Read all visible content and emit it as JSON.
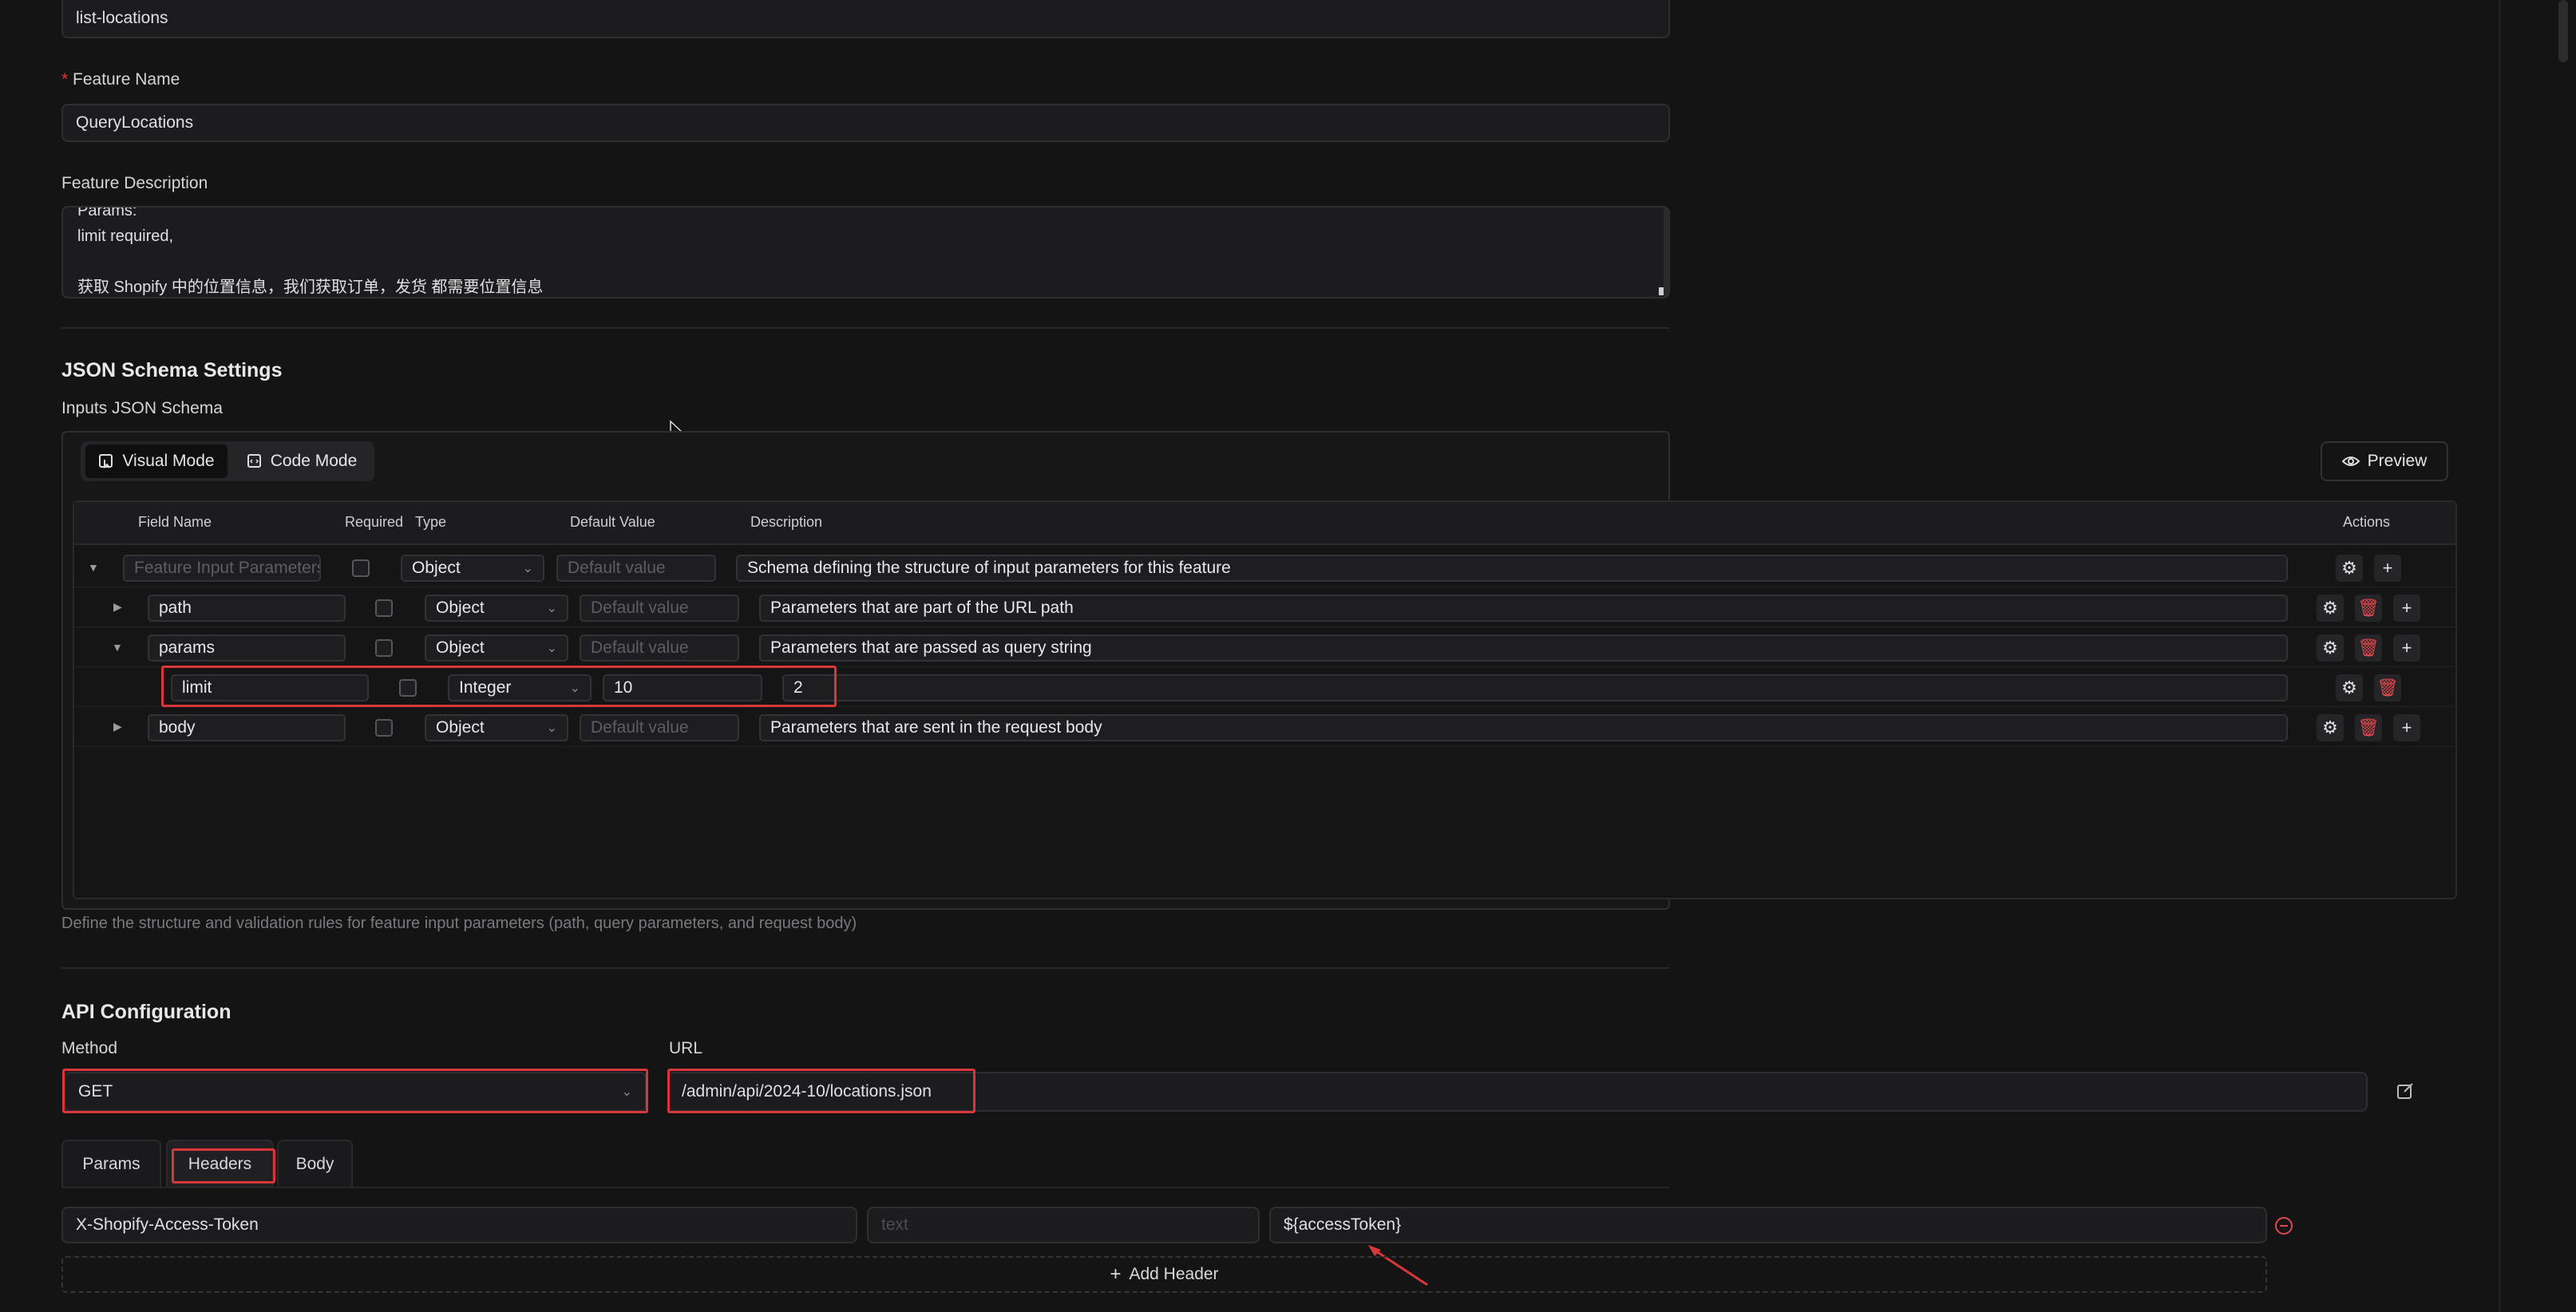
{
  "top_field": {
    "value": "list-locations"
  },
  "feature_name": {
    "label": "Feature Name",
    "required_mark": "*",
    "value": "QueryLocations"
  },
  "feature_description": {
    "label": "Feature Description",
    "lines": [
      "Params:",
      "limit required,",
      "",
      "获取 Shopify 中的位置信息，我们获取订单，发货 都需要位置信息"
    ]
  },
  "json_schema": {
    "title": "JSON Schema Settings",
    "subtitle": "Inputs JSON Schema",
    "mode_visual": "Visual Mode",
    "mode_code": "Code Mode",
    "preview": "Preview",
    "columns": {
      "field_name": "Field Name",
      "required": "Required",
      "type": "Type",
      "default_value": "Default Value",
      "description": "Description",
      "actions": "Actions"
    },
    "root": {
      "name_placeholder": "Feature Input Parameters",
      "type": "Object",
      "default_placeholder": "Default value",
      "description": "Schema defining the structure of input parameters for this feature"
    },
    "rows": {
      "path": {
        "name": "path",
        "type": "Object",
        "default_placeholder": "Default value",
        "description": "Parameters that are part of the URL path"
      },
      "params": {
        "name": "params",
        "type": "Object",
        "default_placeholder": "Default value",
        "description": "Parameters that are passed as query string"
      },
      "limit": {
        "name": "limit",
        "type": "Integer",
        "default": "10",
        "description": "2"
      },
      "body": {
        "name": "body",
        "type": "Object",
        "default_placeholder": "Default value",
        "description": "Parameters that are sent in the request body"
      }
    },
    "help": "Define the structure and validation rules for feature input parameters (path, query parameters, and request body)"
  },
  "api": {
    "title": "API Configuration",
    "method_label": "Method",
    "method": "GET",
    "url_label": "URL",
    "url": "/admin/api/2024-10/locations.json",
    "tabs": [
      "Params",
      "Headers",
      "Body"
    ],
    "header": {
      "key": "X-Shopify-Access-Token",
      "type_placeholder": "text",
      "value": "${accessToken}"
    },
    "add_header": "Add Header"
  },
  "colors": {
    "highlight": "#d8363a",
    "background": "#141415",
    "delete": "#e0484b"
  }
}
